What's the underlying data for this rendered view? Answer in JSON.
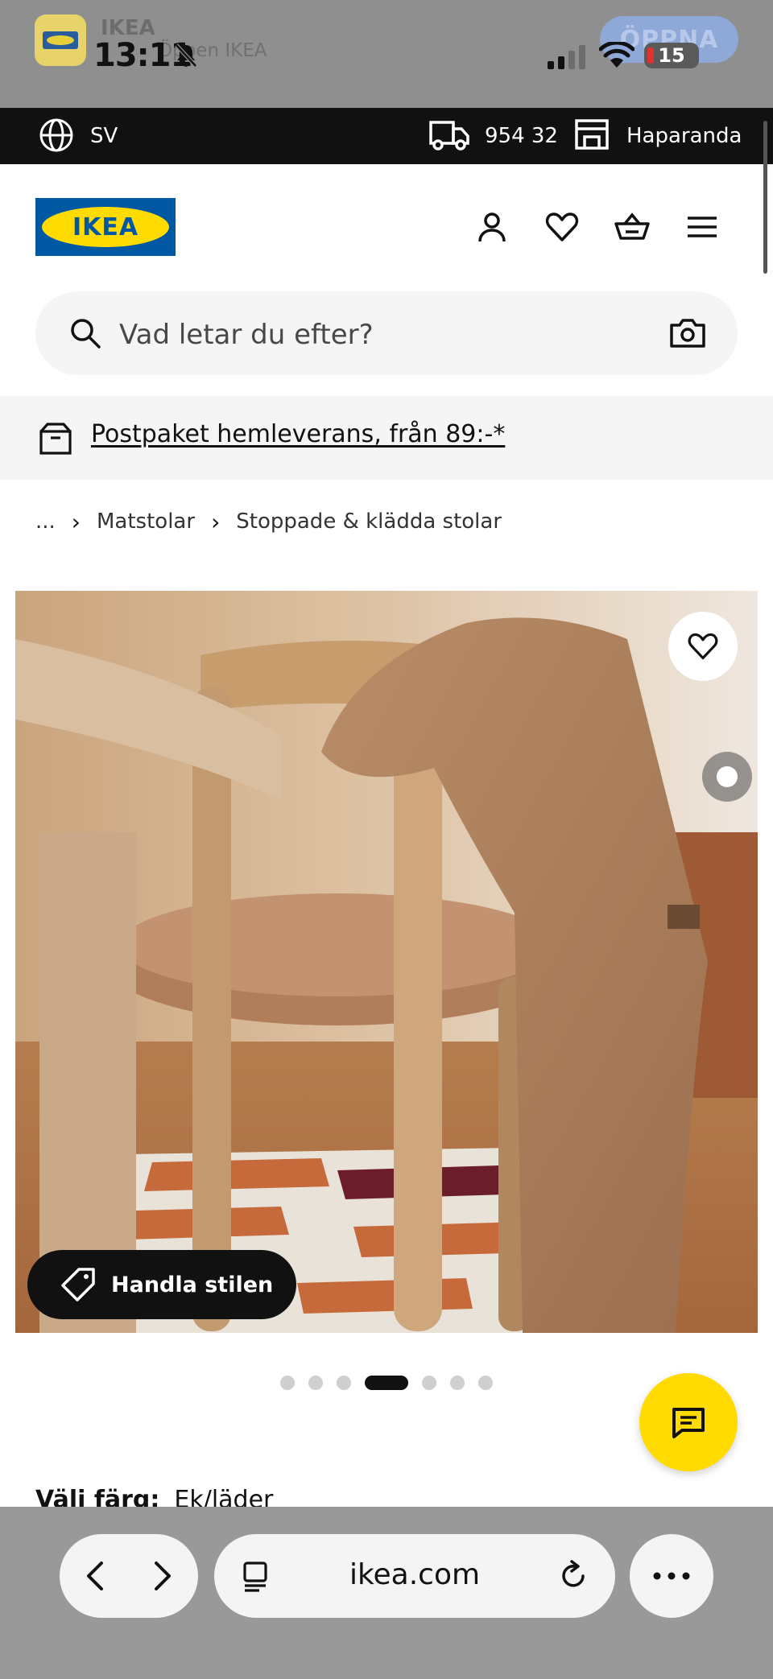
{
  "status_bar": {
    "time": "13:11",
    "battery": "15"
  },
  "app_banner": {
    "app_name": "IKEA",
    "subtitle": "Öppen IKEA",
    "open_label": "ÖPPNA"
  },
  "utility_bar": {
    "language": "SV",
    "postal_code": "954 32",
    "store": "Haparanda"
  },
  "header": {
    "logo_text": "IKEA",
    "icons": [
      "user-icon",
      "heart-icon",
      "cart-icon",
      "menu-icon"
    ]
  },
  "search": {
    "placeholder": "Vad letar du efter?"
  },
  "promo": {
    "text": "Postpaket hemleverans, från 89:-*"
  },
  "breadcrumb": {
    "items": [
      "...",
      "Matstolar",
      "Stoppade & klädda stolar"
    ]
  },
  "product_image": {
    "shop_style_label": "Handla stilen",
    "carousel": {
      "total": 7,
      "active": 4
    }
  },
  "color_selector": {
    "label": "Välj färg:",
    "value": "Ek/läder"
  },
  "browser": {
    "url": "ikea.com"
  },
  "colors": {
    "ikea_blue": "#0058a3",
    "ikea_yellow": "#ffdb00",
    "utility_bar_bg": "#111111"
  }
}
